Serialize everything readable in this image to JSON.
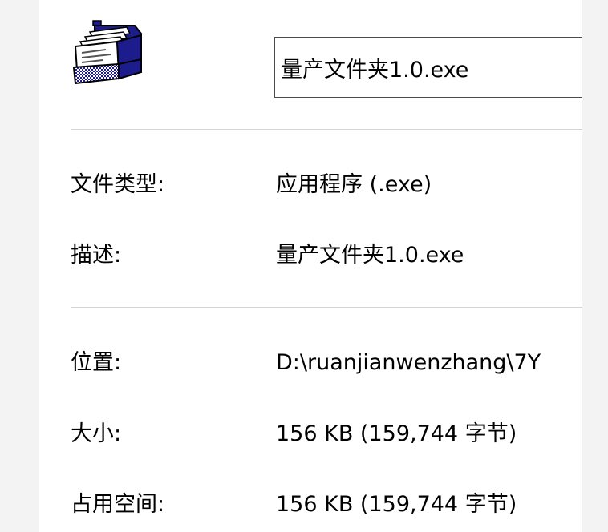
{
  "file_icon": "card-file-icon",
  "file_name": "量产文件夹1.0.exe",
  "properties": [
    {
      "label": "文件类型:",
      "value": "应用程序 (.exe)"
    },
    {
      "label": "描述:",
      "value": "量产文件夹1.0.exe"
    },
    {
      "label": "位置:",
      "value": "D:\\ruanjianwenzhang\\7Y"
    },
    {
      "label": "大小:",
      "value": "156 KB (159,744 字节)"
    },
    {
      "label": "占用空间:",
      "value": "156 KB (159,744 字节)"
    }
  ],
  "colors": {
    "background": "#f3f3f3",
    "panel": "#ffffff",
    "divider": "#d4d4d4",
    "input_border": "#4a4a4a",
    "icon_navy": "#1c1c8c"
  }
}
